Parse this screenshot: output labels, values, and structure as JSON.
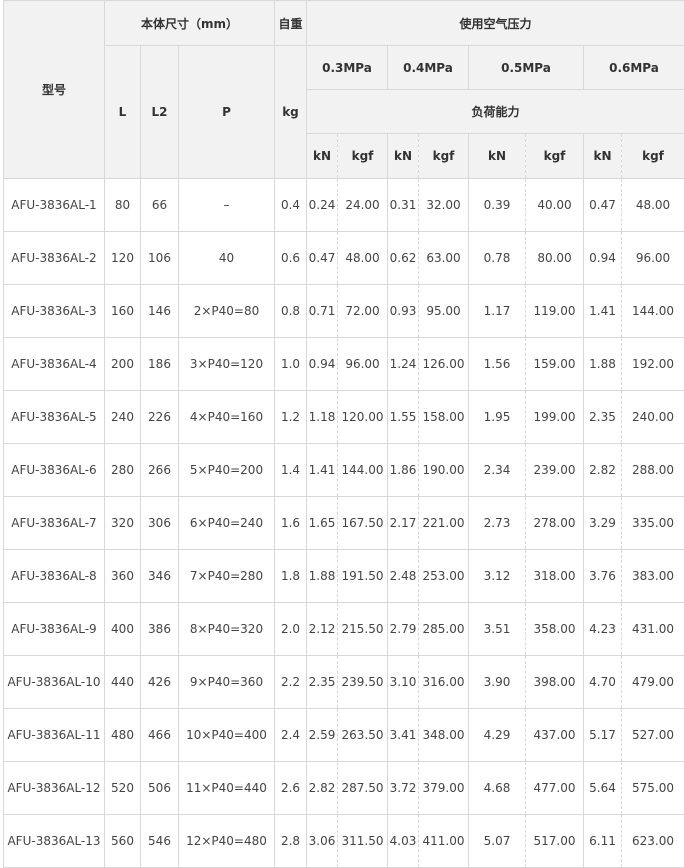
{
  "headers": {
    "model": "型号",
    "body_size": "本体尺寸（mm）",
    "weight": "自重",
    "air_pressure": "使用空气压力",
    "L": "L",
    "L2": "L2",
    "P": "P",
    "kg": "kg",
    "pressures": [
      "0.3MPa",
      "0.4MPa",
      "0.5MPa",
      "0.6MPa"
    ],
    "load_capacity": "负荷能力",
    "unit_kN": "kN",
    "unit_kgf": "kgf"
  },
  "rows": [
    {
      "model": "AFU-3836AL-1",
      "L": "80",
      "L2": "66",
      "P": "–",
      "kg": "0.4",
      "v": [
        "0.24",
        "24.00",
        "0.31",
        "32.00",
        "0.39",
        "40.00",
        "0.47",
        "48.00"
      ]
    },
    {
      "model": "AFU-3836AL-2",
      "L": "120",
      "L2": "106",
      "P": "40",
      "kg": "0.6",
      "v": [
        "0.47",
        "48.00",
        "0.62",
        "63.00",
        "0.78",
        "80.00",
        "0.94",
        "96.00"
      ]
    },
    {
      "model": "AFU-3836AL-3",
      "L": "160",
      "L2": "146",
      "P": "2×P40=80",
      "kg": "0.8",
      "v": [
        "0.71",
        "72.00",
        "0.93",
        "95.00",
        "1.17",
        "119.00",
        "1.41",
        "144.00"
      ]
    },
    {
      "model": "AFU-3836AL-4",
      "L": "200",
      "L2": "186",
      "P": "3×P40=120",
      "kg": "1.0",
      "v": [
        "0.94",
        "96.00",
        "1.24",
        "126.00",
        "1.56",
        "159.00",
        "1.88",
        "192.00"
      ]
    },
    {
      "model": "AFU-3836AL-5",
      "L": "240",
      "L2": "226",
      "P": "4×P40=160",
      "kg": "1.2",
      "v": [
        "1.18",
        "120.00",
        "1.55",
        "158.00",
        "1.95",
        "199.00",
        "2.35",
        "240.00"
      ]
    },
    {
      "model": "AFU-3836AL-6",
      "L": "280",
      "L2": "266",
      "P": "5×P40=200",
      "kg": "1.4",
      "v": [
        "1.41",
        "144.00",
        "1.86",
        "190.00",
        "2.34",
        "239.00",
        "2.82",
        "288.00"
      ]
    },
    {
      "model": "AFU-3836AL-7",
      "L": "320",
      "L2": "306",
      "P": "6×P40=240",
      "kg": "1.6",
      "v": [
        "1.65",
        "167.50",
        "2.17",
        "221.00",
        "2.73",
        "278.00",
        "3.29",
        "335.00"
      ]
    },
    {
      "model": "AFU-3836AL-8",
      "L": "360",
      "L2": "346",
      "P": "7×P40=280",
      "kg": "1.8",
      "v": [
        "1.88",
        "191.50",
        "2.48",
        "253.00",
        "3.12",
        "318.00",
        "3.76",
        "383.00"
      ]
    },
    {
      "model": "AFU-3836AL-9",
      "L": "400",
      "L2": "386",
      "P": "8×P40=320",
      "kg": "2.0",
      "v": [
        "2.12",
        "215.50",
        "2.79",
        "285.00",
        "3.51",
        "358.00",
        "4.23",
        "431.00"
      ]
    },
    {
      "model": "AFU-3836AL-10",
      "L": "440",
      "L2": "426",
      "P": "9×P40=360",
      "kg": "2.2",
      "v": [
        "2.35",
        "239.50",
        "3.10",
        "316.00",
        "3.90",
        "398.00",
        "4.70",
        "479.00"
      ]
    },
    {
      "model": "AFU-3836AL-11",
      "L": "480",
      "L2": "466",
      "P": "10×P40=400",
      "kg": "2.4",
      "v": [
        "2.59",
        "263.50",
        "3.41",
        "348.00",
        "4.29",
        "437.00",
        "5.17",
        "527.00"
      ]
    },
    {
      "model": "AFU-3836AL-12",
      "L": "520",
      "L2": "506",
      "P": "11×P40=440",
      "kg": "2.6",
      "v": [
        "2.82",
        "287.50",
        "3.72",
        "379.00",
        "4.68",
        "477.00",
        "5.64",
        "575.00"
      ]
    },
    {
      "model": "AFU-3836AL-13",
      "L": "560",
      "L2": "546",
      "P": "12×P40=480",
      "kg": "2.8",
      "v": [
        "3.06",
        "311.50",
        "4.03",
        "411.00",
        "5.07",
        "517.00",
        "6.11",
        "623.00"
      ]
    }
  ]
}
